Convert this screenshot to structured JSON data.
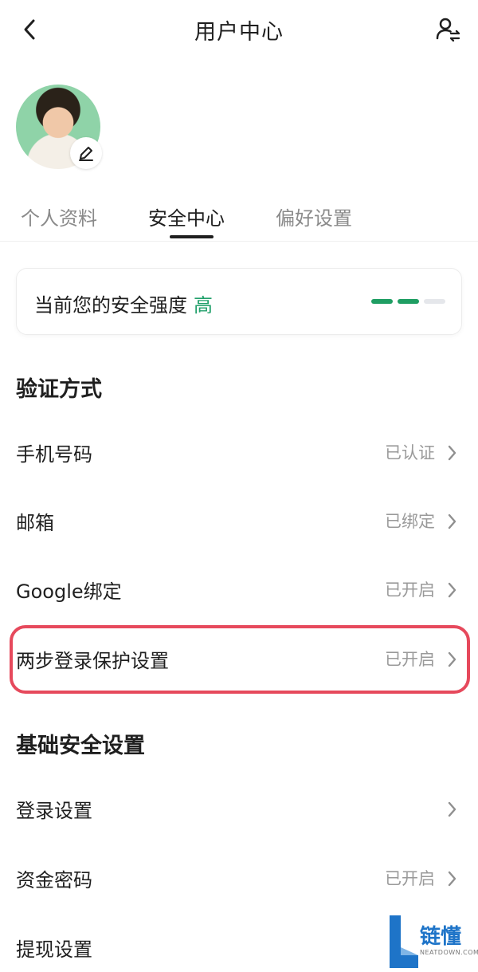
{
  "header": {
    "title": "用户中心"
  },
  "tabs": [
    {
      "label": "个人资料"
    },
    {
      "label": "安全中心"
    },
    {
      "label": "偏好设置"
    }
  ],
  "security": {
    "prefix": "当前您的安全强度",
    "level": "高",
    "level_color": "#22a06b",
    "strength_bars_filled": 2,
    "strength_bars_total": 3
  },
  "verification": {
    "title": "验证方式",
    "items": [
      {
        "label": "手机号码",
        "status": "已认证"
      },
      {
        "label": "邮箱",
        "status": "已绑定"
      },
      {
        "label": "Google绑定",
        "status": "已开启"
      },
      {
        "label": "两步登录保护设置",
        "status": "已开启"
      }
    ]
  },
  "basic": {
    "title": "基础安全设置",
    "items": [
      {
        "label": "登录设置",
        "status": ""
      },
      {
        "label": "资金密码",
        "status": "已开启"
      },
      {
        "label": "提现设置",
        "status": ""
      }
    ]
  },
  "watermark": {
    "brand": "链懂",
    "site": "NEATDOWN.COM"
  },
  "colors": {
    "highlight": "#e6495c",
    "accent": "#1f9e63"
  }
}
